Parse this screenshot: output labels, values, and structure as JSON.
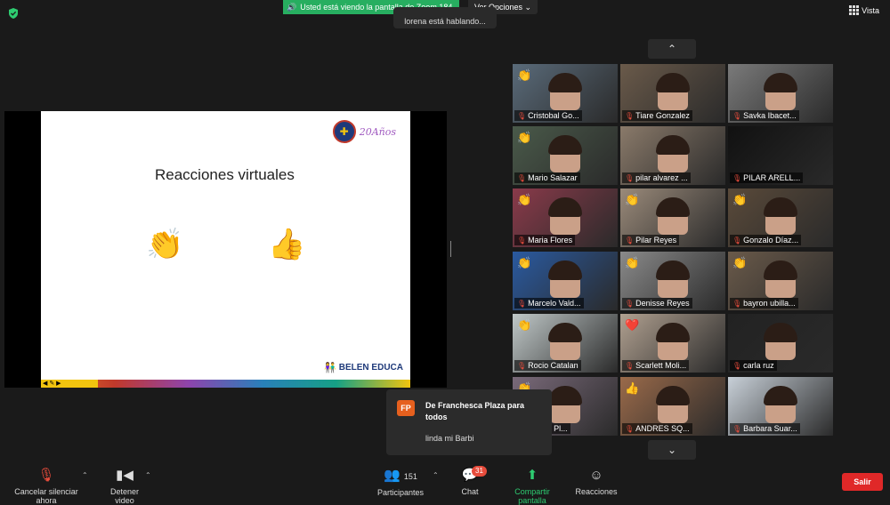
{
  "top": {
    "banner_text": "Usted está viendo la pantalla de Zoom 184",
    "view_options": "Ver Opciones",
    "speaking": "lorena está hablando...",
    "vista": "Vista"
  },
  "slide": {
    "title": "Reacciones virtuales",
    "anos": "20Años",
    "school": "BELEN EDUCA"
  },
  "gallery": {
    "up_icon": "chevron-up-icon",
    "down_icon": "chevron-down-icon",
    "tiles": [
      {
        "name": "Cristobal Go...",
        "reaction": "👏"
      },
      {
        "name": "Tiare Gonzalez",
        "reaction": ""
      },
      {
        "name": "Savka Ibacet...",
        "reaction": ""
      },
      {
        "name": "Mario Salazar",
        "reaction": "👏"
      },
      {
        "name": "pilar alvarez ...",
        "reaction": ""
      },
      {
        "name": "PILAR ARELL...",
        "reaction": ""
      },
      {
        "name": "Maria Flores",
        "reaction": "👏"
      },
      {
        "name": "Pilar Reyes",
        "reaction": "👏"
      },
      {
        "name": "Gonzalo Díaz...",
        "reaction": "👏"
      },
      {
        "name": "Marcelo Vald...",
        "reaction": "👏"
      },
      {
        "name": "Denisse Reyes",
        "reaction": "👏"
      },
      {
        "name": "bayron ubilla...",
        "reaction": "👏"
      },
      {
        "name": "Rocio Catalan",
        "reaction": "👏"
      },
      {
        "name": "Scarlett Moli...",
        "reaction": "❤️"
      },
      {
        "name": "carla ruz",
        "reaction": ""
      },
      {
        "name": "...esca Pl...",
        "reaction": "👏"
      },
      {
        "name": "ANDRES SQ...",
        "reaction": "👍"
      },
      {
        "name": "Barbara Suar...",
        "reaction": ""
      }
    ]
  },
  "chat_popup": {
    "initials": "FP",
    "from": "De Franchesca Plaza para todos",
    "message": "linda mi Barbi"
  },
  "bottom_bar": {
    "mute": "Cancelar silenciar ahora",
    "video": "Detener video",
    "participants": "Participantes",
    "participants_count": "151",
    "chat": "Chat",
    "chat_badge": "31",
    "share": "Compartir pantalla",
    "reactions": "Reacciones",
    "leave": "Salir"
  }
}
